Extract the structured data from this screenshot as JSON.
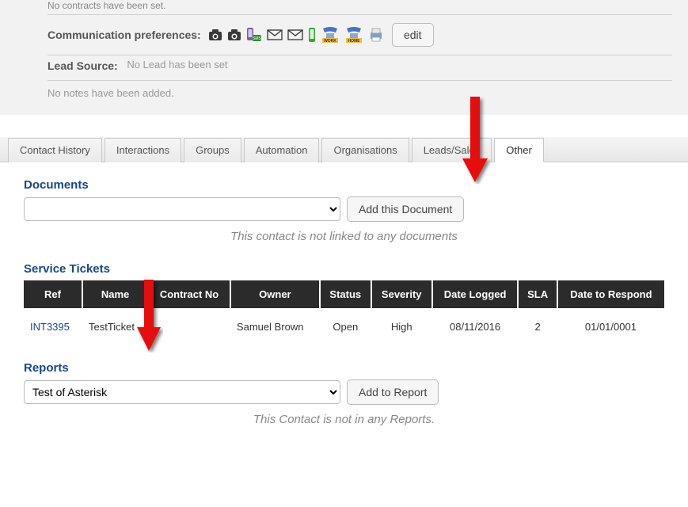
{
  "top": {
    "truncated": "No contracts have been set.",
    "comm_label": "Communication preferences:",
    "edit_label": "edit",
    "lead_label": "Lead Source:",
    "lead_value": "No Lead has been set",
    "notes": "No notes have been added."
  },
  "tabs": [
    "Contact History",
    "Interactions",
    "Groups",
    "Automation",
    "Organisations",
    "Leads/Sales",
    "Other"
  ],
  "active_tab": 6,
  "documents": {
    "title": "Documents",
    "add_label": "Add this Document",
    "empty": "This contact is not linked to any documents"
  },
  "tickets": {
    "title": "Service Tickets",
    "columns": [
      "Ref",
      "Name",
      "Contract No",
      "Owner",
      "Status",
      "Severity",
      "Date Logged",
      "SLA",
      "Date to Respond"
    ],
    "rows": [
      {
        "ref": "INT3395",
        "name": "TestTicket",
        "contract_no": "",
        "owner": "Samuel Brown",
        "status": "Open",
        "severity": "High",
        "date_logged": "08/11/2016",
        "sla": "2",
        "date_respond": "01/01/0001"
      }
    ]
  },
  "reports": {
    "title": "Reports",
    "selected": "Test of Asterisk",
    "add_label": "Add to Report",
    "empty": "This Contact is not in any Reports."
  }
}
